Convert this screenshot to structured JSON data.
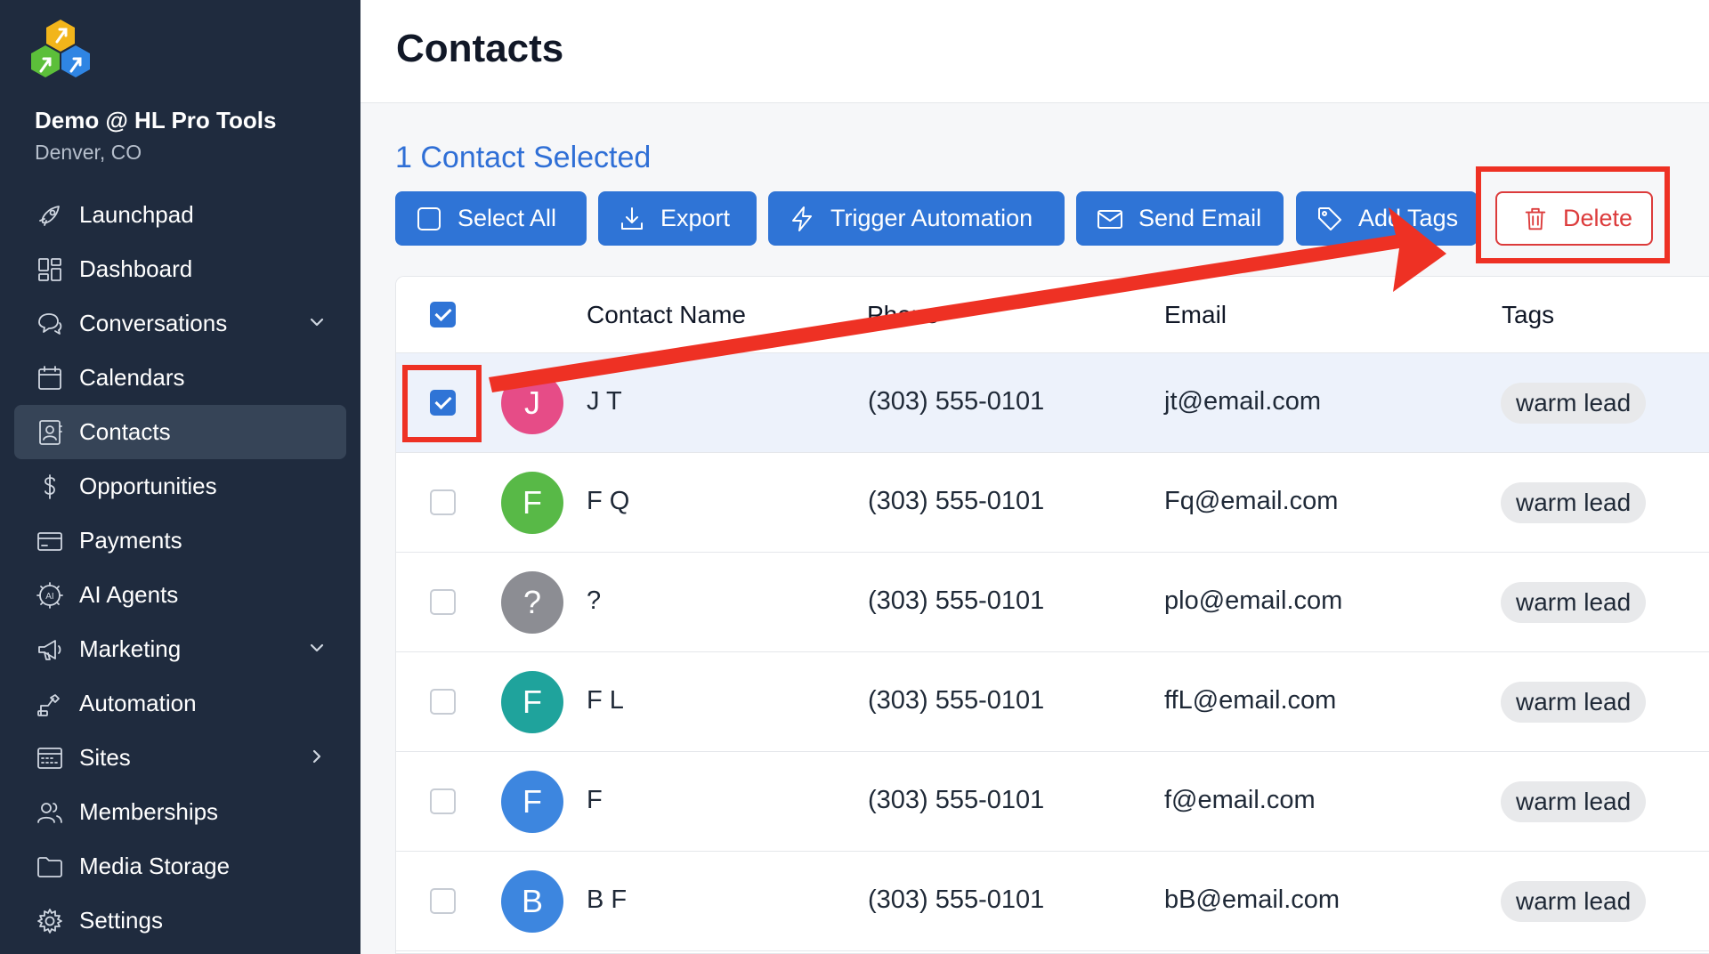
{
  "sidebar": {
    "brand": "Demo @ HL Pro Tools",
    "location": "Denver, CO",
    "items": [
      {
        "label": "Launchpad",
        "icon": "rocket-icon"
      },
      {
        "label": "Dashboard",
        "icon": "dashboard-icon"
      },
      {
        "label": "Conversations",
        "icon": "chat-icon",
        "chevron": "down"
      },
      {
        "label": "Calendars",
        "icon": "calendar-icon"
      },
      {
        "label": "Contacts",
        "icon": "contact-card-icon",
        "active": true
      },
      {
        "label": "Opportunities",
        "icon": "dollar-icon"
      },
      {
        "label": "Payments",
        "icon": "credit-card-icon"
      },
      {
        "label": "AI Agents",
        "icon": "ai-agent-icon"
      },
      {
        "label": "Marketing",
        "icon": "megaphone-icon",
        "chevron": "down"
      },
      {
        "label": "Automation",
        "icon": "automation-icon"
      },
      {
        "label": "Sites",
        "icon": "sites-icon",
        "chevron": "right"
      },
      {
        "label": "Memberships",
        "icon": "users-icon"
      },
      {
        "label": "Media Storage",
        "icon": "folder-icon"
      },
      {
        "label": "Settings",
        "icon": "gear-icon"
      }
    ]
  },
  "header": {
    "title": "Contacts"
  },
  "selection": {
    "text": "1 Contact Selected"
  },
  "toolbar": {
    "select_all": "Select All",
    "export": "Export",
    "trigger_automation": "Trigger Automation",
    "send_email": "Send Email",
    "add_tags": "Add Tags",
    "delete": "Delete"
  },
  "table": {
    "columns": [
      "Contact Name",
      "Phone",
      "Email",
      "Tags"
    ],
    "rows": [
      {
        "initial": "J",
        "name": "J T",
        "phone": "(303) 555-0101",
        "email": "jt@email.com",
        "tag": "warm lead",
        "checked": true,
        "color": "#e64c87"
      },
      {
        "initial": "F",
        "name": "F Q",
        "phone": "(303) 555-0101",
        "email": "Fq@email.com",
        "tag": "warm lead",
        "checked": false,
        "color": "#58b947"
      },
      {
        "initial": "?",
        "name": "?",
        "phone": "(303) 555-0101",
        "email": "plo@email.com",
        "tag": "warm lead",
        "checked": false,
        "color": "#8c8d93"
      },
      {
        "initial": "F",
        "name": "F L",
        "phone": "(303) 555-0101",
        "email": "ffL@email.com",
        "tag": "warm lead",
        "checked": false,
        "color": "#1fa39c"
      },
      {
        "initial": "F",
        "name": "F",
        "phone": "(303) 555-0101",
        "email": "f@email.com",
        "tag": "warm lead",
        "checked": false,
        "color": "#3d86df"
      },
      {
        "initial": "B",
        "name": "B F",
        "phone": "(303) 555-0101",
        "email": "bB@email.com",
        "tag": "warm lead",
        "checked": false,
        "color": "#3d86df"
      }
    ]
  },
  "colors": {
    "accent": "#2f74d6",
    "annotation": "#ee3124",
    "sidebar": "#1f2b3e"
  }
}
